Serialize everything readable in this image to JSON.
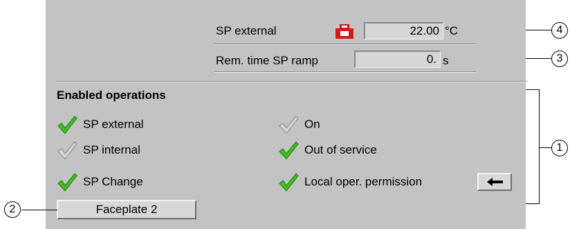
{
  "setpoint": {
    "sp_external_label": "SP external",
    "sp_external_value": "22.00",
    "sp_external_unit": "°C",
    "rem_time_label": "Rem. time SP ramp",
    "rem_time_value": "0.",
    "rem_time_unit": "s"
  },
  "enabled_operations": {
    "title": "Enabled operations",
    "items": [
      {
        "label": "SP external",
        "enabled": true
      },
      {
        "label": "SP internal",
        "enabled": false
      },
      {
        "label": "SP Change",
        "enabled": true
      },
      {
        "label": "On",
        "enabled": false
      },
      {
        "label": "Out of service",
        "enabled": true
      },
      {
        "label": "Local oper. permission",
        "enabled": true
      }
    ]
  },
  "faceplate_button_label": "Faceplate 2",
  "callouts": [
    "4",
    "3",
    "1",
    "2"
  ],
  "colors": {
    "panel": "#c3c3c3",
    "check_enabled": "#3fbf1f",
    "check_disabled": "#9a9a9a",
    "icon_red": "#d11a1a"
  },
  "icons": {
    "sp_external_status": "external-setpoint-icon",
    "check": "checkmark-icon",
    "arrow": "arrow-left-icon"
  }
}
